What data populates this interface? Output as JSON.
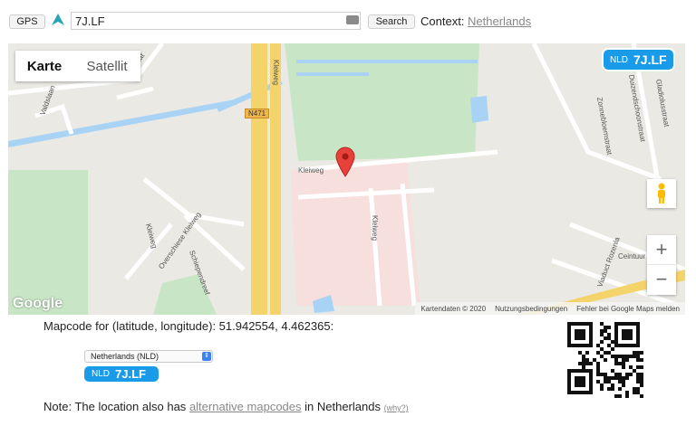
{
  "toolbar": {
    "gps_label": "GPS",
    "query_value": "7J.LF",
    "search_label": "Search",
    "context_label": "Context:",
    "context_value": "Netherlands"
  },
  "map": {
    "type_tabs": [
      "Karte",
      "Satellit"
    ],
    "badge": {
      "country": "NLD",
      "code": "7J.LF"
    },
    "road_labels": {
      "n471": "N471",
      "kleiweg_h": "Kleiweg",
      "kleiweg_v": "Kleiweg",
      "kleiweg_top": "Kleiweg",
      "kleiweg_left": "Kleiweg",
      "zonnebloemstraat": "Zonnebloemstraat",
      "duizendschoonstraat": "Duizendschoonstraat",
      "gladiolusstraat": "Gladiolusstraat",
      "viaduct": "Viaduct Rozenla",
      "ceintuur": "Ceintuur",
      "overschiese": "Overschiese Kleiweg",
      "schiepen": "Schiependreef",
      "valdslaan": "Valdslaan",
      "arnstraat": "Arnstraat"
    },
    "zoom_in": "+",
    "zoom_out": "−",
    "google_logo": "Google",
    "attribution": [
      "Kartendaten © 2020",
      "Nutzungsbedingungen",
      "Fehler bei Google Maps melden"
    ],
    "icons": {
      "marker": "map-pin-icon",
      "pegman": "pegman-icon"
    }
  },
  "result": {
    "coords_text": "Mapcode for (latitude, longitude): 51.942554, 4.462365:",
    "territory_select": "Netherlands (NLD)",
    "badge": {
      "country": "NLD",
      "code": "7J.LF"
    },
    "note_prefix": "Note: The location also has",
    "note_link": "alternative mapcodes",
    "note_suffix": "in Netherlands",
    "why_link": "(why?)"
  },
  "colors": {
    "accent": "#1a9be9",
    "map_bg": "#ebe9e4",
    "park": "#c8e6c6",
    "water": "#a9d3f5",
    "highway": "#f5d36b",
    "industrial": "#f6dfdd"
  }
}
